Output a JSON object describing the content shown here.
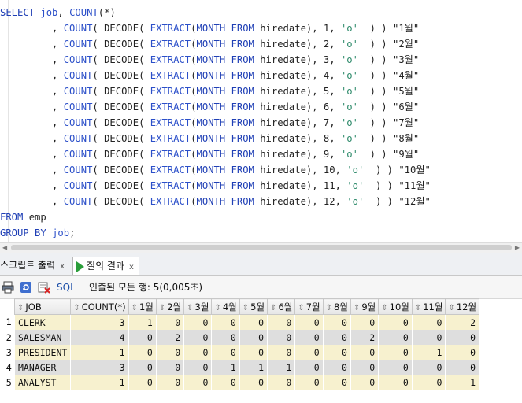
{
  "editor": {
    "lines": [
      [
        {
          "t": "SELECT ",
          "c": "kw"
        },
        {
          "t": "job",
          "c": "fn"
        },
        {
          "t": ", ",
          "c": ""
        },
        {
          "t": "COUNT",
          "c": "fn"
        },
        {
          "t": "(*)",
          "c": ""
        }
      ],
      [
        {
          "t": "         , ",
          "c": ""
        },
        {
          "t": "COUNT",
          "c": "fn"
        },
        {
          "t": "( DECODE( ",
          "c": ""
        },
        {
          "t": "EXTRACT",
          "c": "fn"
        },
        {
          "t": "(",
          "c": ""
        },
        {
          "t": "MONTH FROM",
          "c": "kw"
        },
        {
          "t": " hiredate), 1, ",
          "c": ""
        },
        {
          "t": "'o'",
          "c": "str"
        },
        {
          "t": "  ) ) ",
          "c": ""
        },
        {
          "t": "\"1월\"",
          "c": "dq"
        }
      ],
      [
        {
          "t": "         , ",
          "c": ""
        },
        {
          "t": "COUNT",
          "c": "fn"
        },
        {
          "t": "( DECODE( ",
          "c": ""
        },
        {
          "t": "EXTRACT",
          "c": "fn"
        },
        {
          "t": "(",
          "c": ""
        },
        {
          "t": "MONTH FROM",
          "c": "kw"
        },
        {
          "t": " hiredate), 2, ",
          "c": ""
        },
        {
          "t": "'o'",
          "c": "str"
        },
        {
          "t": "  ) ) ",
          "c": ""
        },
        {
          "t": "\"2월\"",
          "c": "dq"
        }
      ],
      [
        {
          "t": "         , ",
          "c": ""
        },
        {
          "t": "COUNT",
          "c": "fn"
        },
        {
          "t": "( DECODE( ",
          "c": ""
        },
        {
          "t": "EXTRACT",
          "c": "fn"
        },
        {
          "t": "(",
          "c": ""
        },
        {
          "t": "MONTH FROM",
          "c": "kw"
        },
        {
          "t": " hiredate), 3, ",
          "c": ""
        },
        {
          "t": "'o'",
          "c": "str"
        },
        {
          "t": "  ) ) ",
          "c": ""
        },
        {
          "t": "\"3월\"",
          "c": "dq"
        }
      ],
      [
        {
          "t": "         , ",
          "c": ""
        },
        {
          "t": "COUNT",
          "c": "fn"
        },
        {
          "t": "( DECODE( ",
          "c": ""
        },
        {
          "t": "EXTRACT",
          "c": "fn"
        },
        {
          "t": "(",
          "c": ""
        },
        {
          "t": "MONTH FROM",
          "c": "kw"
        },
        {
          "t": " hiredate), 4, ",
          "c": ""
        },
        {
          "t": "'o'",
          "c": "str"
        },
        {
          "t": "  ) ) ",
          "c": ""
        },
        {
          "t": "\"4월\"",
          "c": "dq"
        }
      ],
      [
        {
          "t": "         , ",
          "c": ""
        },
        {
          "t": "COUNT",
          "c": "fn"
        },
        {
          "t": "( DECODE( ",
          "c": ""
        },
        {
          "t": "EXTRACT",
          "c": "fn"
        },
        {
          "t": "(",
          "c": ""
        },
        {
          "t": "MONTH FROM",
          "c": "kw"
        },
        {
          "t": " hiredate), 5, ",
          "c": ""
        },
        {
          "t": "'o'",
          "c": "str"
        },
        {
          "t": "  ) ) ",
          "c": ""
        },
        {
          "t": "\"5월\"",
          "c": "dq"
        }
      ],
      [
        {
          "t": "         , ",
          "c": ""
        },
        {
          "t": "COUNT",
          "c": "fn"
        },
        {
          "t": "( DECODE( ",
          "c": ""
        },
        {
          "t": "EXTRACT",
          "c": "fn"
        },
        {
          "t": "(",
          "c": ""
        },
        {
          "t": "MONTH FROM",
          "c": "kw"
        },
        {
          "t": " hiredate), 6, ",
          "c": ""
        },
        {
          "t": "'o'",
          "c": "str"
        },
        {
          "t": "  ) ) ",
          "c": ""
        },
        {
          "t": "\"6월\"",
          "c": "dq"
        }
      ],
      [
        {
          "t": "         , ",
          "c": ""
        },
        {
          "t": "COUNT",
          "c": "fn"
        },
        {
          "t": "( DECODE( ",
          "c": ""
        },
        {
          "t": "EXTRACT",
          "c": "fn"
        },
        {
          "t": "(",
          "c": ""
        },
        {
          "t": "MONTH FROM",
          "c": "kw"
        },
        {
          "t": " hiredate), 7, ",
          "c": ""
        },
        {
          "t": "'o'",
          "c": "str"
        },
        {
          "t": "  ) ) ",
          "c": ""
        },
        {
          "t": "\"7월\"",
          "c": "dq"
        }
      ],
      [
        {
          "t": "         , ",
          "c": ""
        },
        {
          "t": "COUNT",
          "c": "fn"
        },
        {
          "t": "( DECODE( ",
          "c": ""
        },
        {
          "t": "EXTRACT",
          "c": "fn"
        },
        {
          "t": "(",
          "c": ""
        },
        {
          "t": "MONTH FROM",
          "c": "kw"
        },
        {
          "t": " hiredate), 8, ",
          "c": ""
        },
        {
          "t": "'o'",
          "c": "str"
        },
        {
          "t": "  ) ) ",
          "c": ""
        },
        {
          "t": "\"8월\"",
          "c": "dq"
        }
      ],
      [
        {
          "t": "         , ",
          "c": ""
        },
        {
          "t": "COUNT",
          "c": "fn"
        },
        {
          "t": "( DECODE( ",
          "c": ""
        },
        {
          "t": "EXTRACT",
          "c": "fn"
        },
        {
          "t": "(",
          "c": ""
        },
        {
          "t": "MONTH FROM",
          "c": "kw"
        },
        {
          "t": " hiredate), 9, ",
          "c": ""
        },
        {
          "t": "'o'",
          "c": "str"
        },
        {
          "t": "  ) ) ",
          "c": ""
        },
        {
          "t": "\"9월\"",
          "c": "dq"
        }
      ],
      [
        {
          "t": "         , ",
          "c": ""
        },
        {
          "t": "COUNT",
          "c": "fn"
        },
        {
          "t": "( DECODE( ",
          "c": ""
        },
        {
          "t": "EXTRACT",
          "c": "fn"
        },
        {
          "t": "(",
          "c": ""
        },
        {
          "t": "MONTH FROM",
          "c": "kw"
        },
        {
          "t": " hiredate), 10, ",
          "c": ""
        },
        {
          "t": "'o'",
          "c": "str"
        },
        {
          "t": "  ) ) ",
          "c": ""
        },
        {
          "t": "\"10월\"",
          "c": "dq"
        }
      ],
      [
        {
          "t": "         , ",
          "c": ""
        },
        {
          "t": "COUNT",
          "c": "fn"
        },
        {
          "t": "( DECODE( ",
          "c": ""
        },
        {
          "t": "EXTRACT",
          "c": "fn"
        },
        {
          "t": "(",
          "c": ""
        },
        {
          "t": "MONTH FROM",
          "c": "kw"
        },
        {
          "t": " hiredate), 11, ",
          "c": ""
        },
        {
          "t": "'o'",
          "c": "str"
        },
        {
          "t": "  ) ) ",
          "c": ""
        },
        {
          "t": "\"11월\"",
          "c": "dq"
        }
      ],
      [
        {
          "t": "         , ",
          "c": ""
        },
        {
          "t": "COUNT",
          "c": "fn"
        },
        {
          "t": "( DECODE( ",
          "c": ""
        },
        {
          "t": "EXTRACT",
          "c": "fn"
        },
        {
          "t": "(",
          "c": ""
        },
        {
          "t": "MONTH FROM",
          "c": "kw"
        },
        {
          "t": " hiredate), 12, ",
          "c": ""
        },
        {
          "t": "'o'",
          "c": "str"
        },
        {
          "t": "  ) ) ",
          "c": ""
        },
        {
          "t": "\"12월\"",
          "c": "dq"
        }
      ],
      [
        {
          "t": "FROM ",
          "c": "kw"
        },
        {
          "t": "emp",
          "c": ""
        }
      ],
      [
        {
          "t": "GROUP BY ",
          "c": "kw"
        },
        {
          "t": "job",
          "c": "fn"
        },
        {
          "t": ";",
          "c": ""
        }
      ]
    ]
  },
  "tabs": [
    {
      "label": "스크립트 출력",
      "close": "x",
      "active": false
    },
    {
      "label": "질의 결과",
      "close": "x",
      "active": true
    }
  ],
  "toolbar": {
    "print_icon": "print-icon",
    "refresh_icon": "refresh-icon",
    "clear_icon": "clear-icon",
    "sql_label": "SQL",
    "status": "인출된 모든 행: 5(0,005초)"
  },
  "grid": {
    "columns": [
      "JOB",
      "COUNT(*)",
      "1월",
      "2월",
      "3월",
      "4월",
      "5월",
      "6월",
      "7월",
      "8월",
      "9월",
      "10월",
      "11월",
      "12월"
    ],
    "rows": [
      {
        "n": "1",
        "cells": [
          "CLERK",
          "3",
          "1",
          "0",
          "0",
          "0",
          "0",
          "0",
          "0",
          "0",
          "0",
          "0",
          "0",
          "2"
        ]
      },
      {
        "n": "2",
        "cells": [
          "SALESMAN",
          "4",
          "0",
          "2",
          "0",
          "0",
          "0",
          "0",
          "0",
          "0",
          "2",
          "0",
          "0",
          "0"
        ]
      },
      {
        "n": "3",
        "cells": [
          "PRESIDENT",
          "1",
          "0",
          "0",
          "0",
          "0",
          "0",
          "0",
          "0",
          "0",
          "0",
          "0",
          "1",
          "0"
        ]
      },
      {
        "n": "4",
        "cells": [
          "MANAGER",
          "3",
          "0",
          "0",
          "0",
          "1",
          "1",
          "1",
          "0",
          "0",
          "0",
          "0",
          "0",
          "0"
        ]
      },
      {
        "n": "5",
        "cells": [
          "ANALYST",
          "1",
          "0",
          "0",
          "0",
          "0",
          "0",
          "0",
          "0",
          "0",
          "0",
          "0",
          "0",
          "1"
        ]
      }
    ]
  },
  "colors": {
    "keyword": "#1f3fb5",
    "string": "#2d8a6a",
    "row_odd": "#f7f1cf",
    "row_even": "#dedede"
  }
}
